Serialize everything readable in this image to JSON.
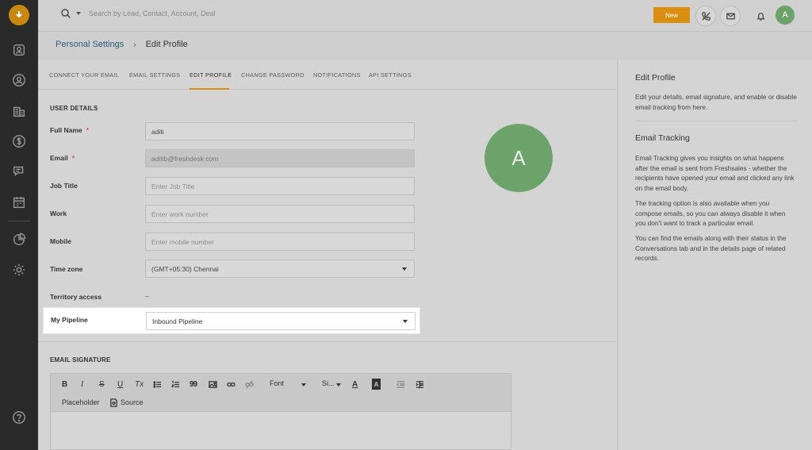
{
  "topbar": {
    "search_placeholder": "Search by Lead, Contact, Account, Deal",
    "new_label": "New",
    "avatar_initial": "A"
  },
  "breadcrumb": {
    "parent": "Personal Settings",
    "separator": "›",
    "current": "Edit Profile"
  },
  "tabs": [
    {
      "label": "CONNECT YOUR EMAIL"
    },
    {
      "label": "EMAIL SETTINGS"
    },
    {
      "label": "EDIT PROFILE"
    },
    {
      "label": "CHANGE PASSWORD"
    },
    {
      "label": "NOTIFICATIONS"
    },
    {
      "label": "API SETTINGS"
    }
  ],
  "user_details": {
    "title": "USER DETAILS",
    "full_name": {
      "label": "Full Name",
      "required": "*",
      "value": "aditi"
    },
    "email": {
      "label": "Email",
      "required": "*",
      "value": "aditib@freshdesk.com"
    },
    "job_title": {
      "label": "Job Title",
      "placeholder": "Enter Job Title"
    },
    "work": {
      "label": "Work",
      "placeholder": "Enter work number"
    },
    "mobile": {
      "label": "Mobile",
      "placeholder": "Enter mobile number"
    },
    "time_zone": {
      "label": "Time zone",
      "value": "(GMT+05:30) Chennai"
    },
    "territory": {
      "label": "Territory access",
      "value": "–"
    },
    "pipeline": {
      "label": "My Pipeline",
      "value": "Inbound Pipeline"
    },
    "avatar_initial": "A"
  },
  "signature": {
    "title": "EMAIL SIGNATURE",
    "toolbar": {
      "bold": "B",
      "italic": "I",
      "strike": "S",
      "underline": "U",
      "clear_format": "Tx",
      "quote": "99",
      "font": "Font",
      "size": "Si...",
      "text_color": "A",
      "bg_color": "A",
      "placeholder": "Placeholder",
      "source": "Source"
    }
  },
  "right_panel": {
    "edit_profile_title": "Edit Profile",
    "edit_profile_text": "Edit your details, email signature, and enable or disable email tracking from here.",
    "tracking_title": "Email Tracking",
    "tracking_p1": "Email Tracking gives you insights on what happens after the email is sent from Freshsales - whether the recipients have opened your email and clicked any link on the email body.",
    "tracking_p2": "The tracking option is also available when you compose emails, so you can always disable it when you don't want to track a particular email.",
    "tracking_p3": "You can find the emails along with their status in the Conversations tab and in the details page of related records."
  },
  "colors": {
    "accent": "#d98e10",
    "avatar": "#6ba36b",
    "sidebar": "#2a2a2a",
    "link": "#2d5c7d"
  }
}
